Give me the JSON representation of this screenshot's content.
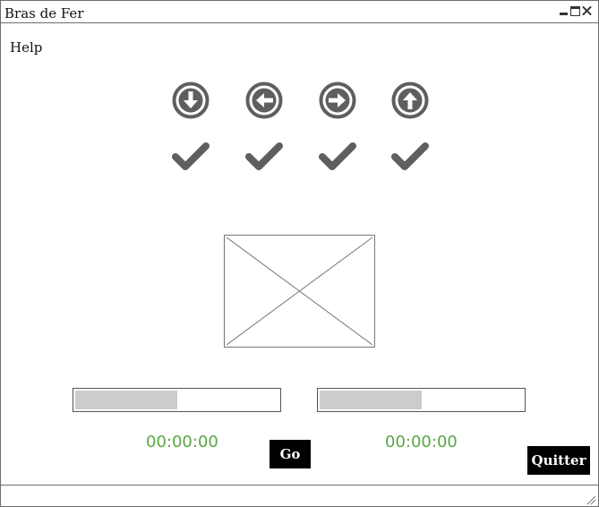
{
  "window": {
    "title": "Bras de Fer"
  },
  "menu": {
    "help_label": "Help"
  },
  "arrows": [
    {
      "icon": "arrow-down-circle-icon"
    },
    {
      "icon": "arrow-left-circle-icon"
    },
    {
      "icon": "arrow-right-circle-icon"
    },
    {
      "icon": "arrow-up-circle-icon"
    }
  ],
  "checks": [
    {
      "icon": "checkmark-icon"
    },
    {
      "icon": "checkmark-icon"
    },
    {
      "icon": "checkmark-icon"
    },
    {
      "icon": "checkmark-icon"
    }
  ],
  "players": {
    "left": {
      "progress": 0.5,
      "timer": "00:00:00"
    },
    "right": {
      "progress": 0.5,
      "timer": "00:00:00"
    }
  },
  "buttons": {
    "go_label": "Go",
    "quit_label": "Quitter"
  },
  "colors": {
    "icon": "#5f5f5f",
    "timer": "#5aa645",
    "bar_fill": "#cccccc",
    "button_bg": "#000000"
  }
}
